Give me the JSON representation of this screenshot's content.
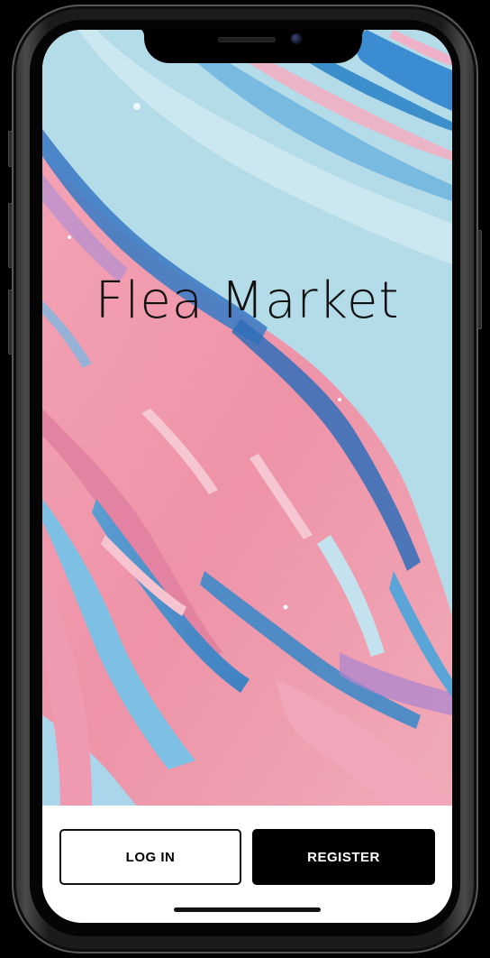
{
  "app": {
    "title": "Flea Market"
  },
  "actions": {
    "login_label": "LOG IN",
    "register_label": "REGISTER"
  },
  "theme": {
    "background_artwork": "pink-blue-marble-fluid-art",
    "primary_button_bg": "#000000",
    "primary_button_text": "#ffffff",
    "secondary_button_bg": "#ffffff",
    "secondary_button_text": "#000000",
    "title_color": "#111111"
  },
  "device": {
    "model_icon": "phone-frame-with-notch"
  }
}
